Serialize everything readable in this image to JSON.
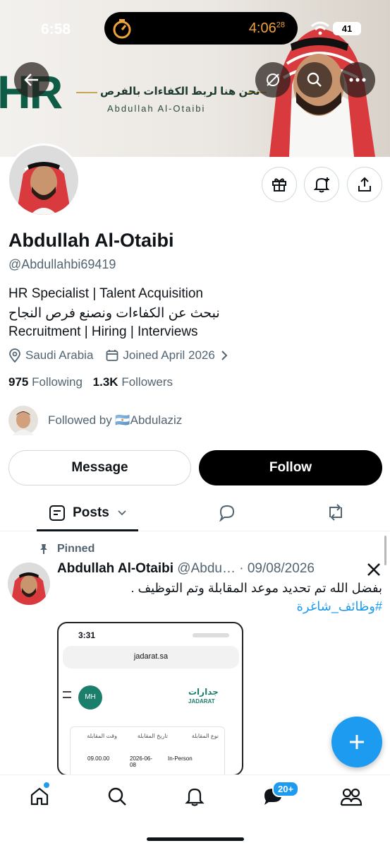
{
  "status_bar": {
    "time": "6:58",
    "timer": "4:06",
    "timer_sup": "28",
    "battery": "41"
  },
  "banner": {
    "logo_text": "HR",
    "tagline_ar": "نحن هنا لربط الكفاءات بالفرص",
    "tagline_en": "Abdullah Al-Otaibi"
  },
  "profile": {
    "name": "Abdullah Al-Otaibi",
    "handle": "@Abdullahbi69419",
    "bio_line1": "HR Specialist | Talent Acquisition",
    "bio_line2": "نبحث عن الكفاءات ونصنع فرص النجاح",
    "bio_line3": "Recruitment | Hiring | Interviews",
    "location": "Saudi Arabia",
    "joined": "Joined April 2026",
    "following_count": "975",
    "following_label": "Following",
    "followers_count": "1.3K",
    "followers_label": "Followers",
    "followed_by": "Followed by 🇦🇷Abdulaziz"
  },
  "actions": {
    "message_label": "Message",
    "follow_label": "Follow"
  },
  "tabs": {
    "posts_label": "Posts"
  },
  "post": {
    "pinned_label": "Pinned",
    "author": "Abdullah Al-Otaibi",
    "handle": "@Abdu…",
    "date": "· 09/08/2026",
    "text": "بفضل الله تم تحديد موعد المقابلة وتم التوظيف .",
    "hashtag": "#وظائف_شاغرة",
    "embed": {
      "time": "3:31",
      "url": "jadarat.sa",
      "avatar_initials": "MH",
      "brand_ar": "جدارات",
      "brand_en": "JADARAT",
      "col1_title": "نوع المقابلة",
      "col1_value": "In-Person",
      "col2_title": "تاريخ المقابلة",
      "col2_value": "2026-06-08",
      "col3_title": "وقت المقابلة",
      "col3_value": "09.00.00"
    }
  },
  "bottom_nav": {
    "messages_badge": "20+"
  },
  "colors": {
    "accent": "#1d9bf0",
    "text": "#0f1419",
    "muted": "#536471",
    "brand_green": "#0e5b46"
  }
}
